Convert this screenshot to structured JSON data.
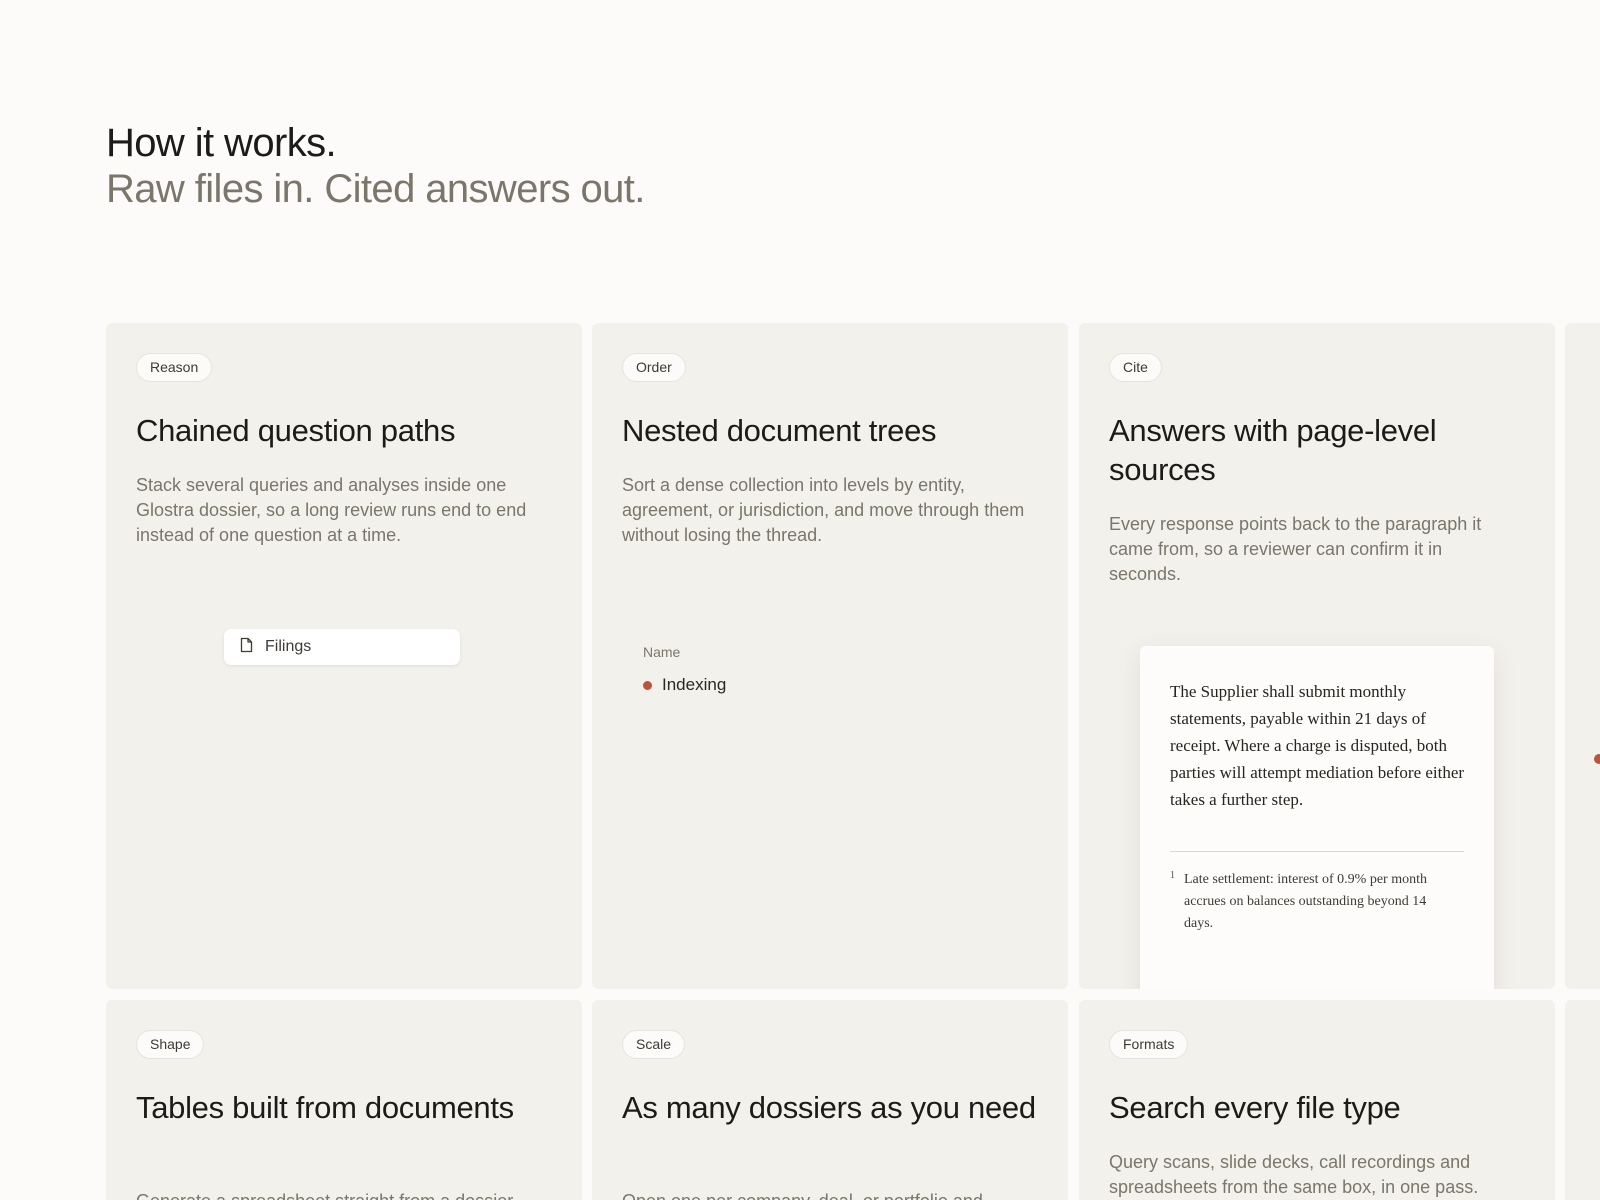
{
  "header": {
    "title": "How it works.",
    "subtitle": "Raw files in. Cited answers out."
  },
  "cards": [
    {
      "tag": "Reason",
      "title": "Chained question paths",
      "desc": "Stack several queries and analyses inside one Glostra dossier, so a long review runs end to end instead of one question at a time.",
      "chip_label": "Filings"
    },
    {
      "tag": "Order",
      "title": "Nested document trees",
      "desc": "Sort a dense collection into levels by entity, agreement, or jurisdiction, and move through them without losing the thread.",
      "tree_header": "Name",
      "tree_item": "Indexing"
    },
    {
      "tag": "Cite",
      "title": "Answers with page-level sources",
      "desc": "Every response points back to the paragraph it came from, so a reviewer can confirm it in seconds.",
      "doc_body": "The Supplier shall submit monthly statements, payable within 21 days of receipt. Where a charge is disputed, both parties will attempt mediation before either takes a further step.",
      "footnote_num": "1",
      "footnote_text": "Late settlement: interest of 0.9% per month accrues on balances outstanding beyond 14 days."
    },
    {
      "tag": "Shape",
      "title": "Tables built from documents",
      "desc": "Generate a spreadsheet straight from a dossier"
    },
    {
      "tag": "Scale",
      "title": "As many dossiers as you need",
      "desc": "Open one per company, deal, or portfolio and"
    },
    {
      "tag": "Formats",
      "title": "Search every file type",
      "desc": "Query scans, slide decks, call recordings and spreadsheets from the same box, in one pass."
    }
  ],
  "colors": {
    "background": "#fcfbf9",
    "card": "#f3f1ec",
    "accent": "#b9553b",
    "muted_text": "#7a7669"
  },
  "icons": {
    "file": "file-icon"
  }
}
